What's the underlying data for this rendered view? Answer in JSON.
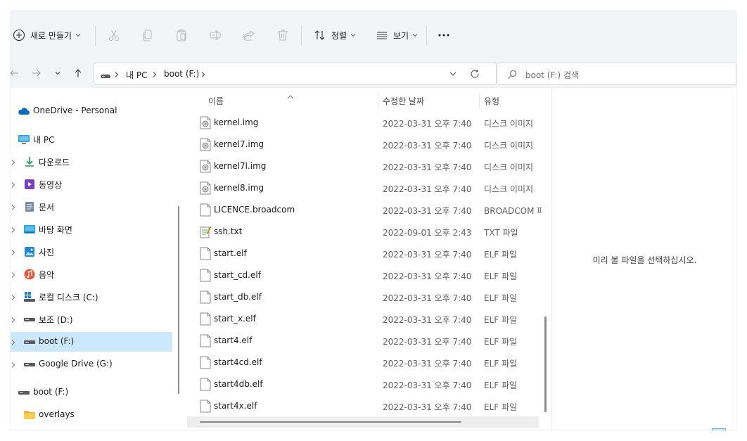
{
  "toolbar": {
    "new_label": "새로 만들기",
    "sort_label": "정렬",
    "view_label": "보기",
    "more_label": "···"
  },
  "address": {
    "crumbs": [
      "내 PC",
      "boot (F:)"
    ]
  },
  "search": {
    "placeholder": "boot (F:) 검색"
  },
  "sidebar": {
    "items": [
      {
        "label": "OneDrive - Personal",
        "icon": "cloud-icon"
      },
      {
        "label": "내 PC",
        "icon": "monitor-icon"
      },
      {
        "label": "다운로드",
        "icon": "download-icon"
      },
      {
        "label": "동영상",
        "icon": "video-icon"
      },
      {
        "label": "문서",
        "icon": "document-icon"
      },
      {
        "label": "바탕 화면",
        "icon": "desktop-icon"
      },
      {
        "label": "사진",
        "icon": "picture-icon"
      },
      {
        "label": "음악",
        "icon": "music-icon"
      },
      {
        "label": "로컬 디스크 (C:)",
        "icon": "windows-drive-icon"
      },
      {
        "label": "보조 (D:)",
        "icon": "drive-icon"
      },
      {
        "label": "boot (F:)",
        "icon": "drive-icon"
      },
      {
        "label": "Google Drive (G:)",
        "icon": "drive-icon"
      },
      {
        "label": "boot (F:)",
        "icon": "drive-icon"
      },
      {
        "label": "overlays",
        "icon": "folder-icon"
      }
    ]
  },
  "columns": {
    "name": "이름",
    "date": "수정한 날짜",
    "type": "유형"
  },
  "files": [
    {
      "name": "kernel.img",
      "date": "2022-03-31 오후 7:40",
      "type": "디스크 이미지",
      "icon": "disk-image-icon"
    },
    {
      "name": "kernel7.img",
      "date": "2022-03-31 오후 7:40",
      "type": "디스크 이미지",
      "icon": "disk-image-icon"
    },
    {
      "name": "kernel7l.img",
      "date": "2022-03-31 오후 7:40",
      "type": "디스크 이미지",
      "icon": "disk-image-icon"
    },
    {
      "name": "kernel8.img",
      "date": "2022-03-31 오후 7:40",
      "type": "디스크 이미지",
      "icon": "disk-image-icon"
    },
    {
      "name": "LICENCE.broadcom",
      "date": "2022-03-31 오후 7:40",
      "type": "BROADCOM 파일",
      "icon": "file-icon"
    },
    {
      "name": "ssh.txt",
      "date": "2022-09-01 오후 2:43",
      "type": "TXT 파일",
      "icon": "text-file-icon"
    },
    {
      "name": "start.elf",
      "date": "2022-03-31 오후 7:40",
      "type": "ELF 파일",
      "icon": "file-icon"
    },
    {
      "name": "start_cd.elf",
      "date": "2022-03-31 오후 7:40",
      "type": "ELF 파일",
      "icon": "file-icon"
    },
    {
      "name": "start_db.elf",
      "date": "2022-03-31 오후 7:40",
      "type": "ELF 파일",
      "icon": "file-icon"
    },
    {
      "name": "start_x.elf",
      "date": "2022-03-31 오후 7:40",
      "type": "ELF 파일",
      "icon": "file-icon"
    },
    {
      "name": "start4.elf",
      "date": "2022-03-31 오후 7:40",
      "type": "ELF 파일",
      "icon": "file-icon"
    },
    {
      "name": "start4cd.elf",
      "date": "2022-03-31 오후 7:40",
      "type": "ELF 파일",
      "icon": "file-icon"
    },
    {
      "name": "start4db.elf",
      "date": "2022-03-31 오후 7:40",
      "type": "ELF 파일",
      "icon": "file-icon"
    },
    {
      "name": "start4x.elf",
      "date": "2022-03-31 오후 7:40",
      "type": "ELF 파일",
      "icon": "file-icon"
    }
  ],
  "preview": {
    "message": "미리 볼 파일을 선택하십시오."
  },
  "colors": {
    "accent": "#0067c0",
    "selection": "#cce8ff",
    "toolbar_bg": "#f3f4f7"
  }
}
